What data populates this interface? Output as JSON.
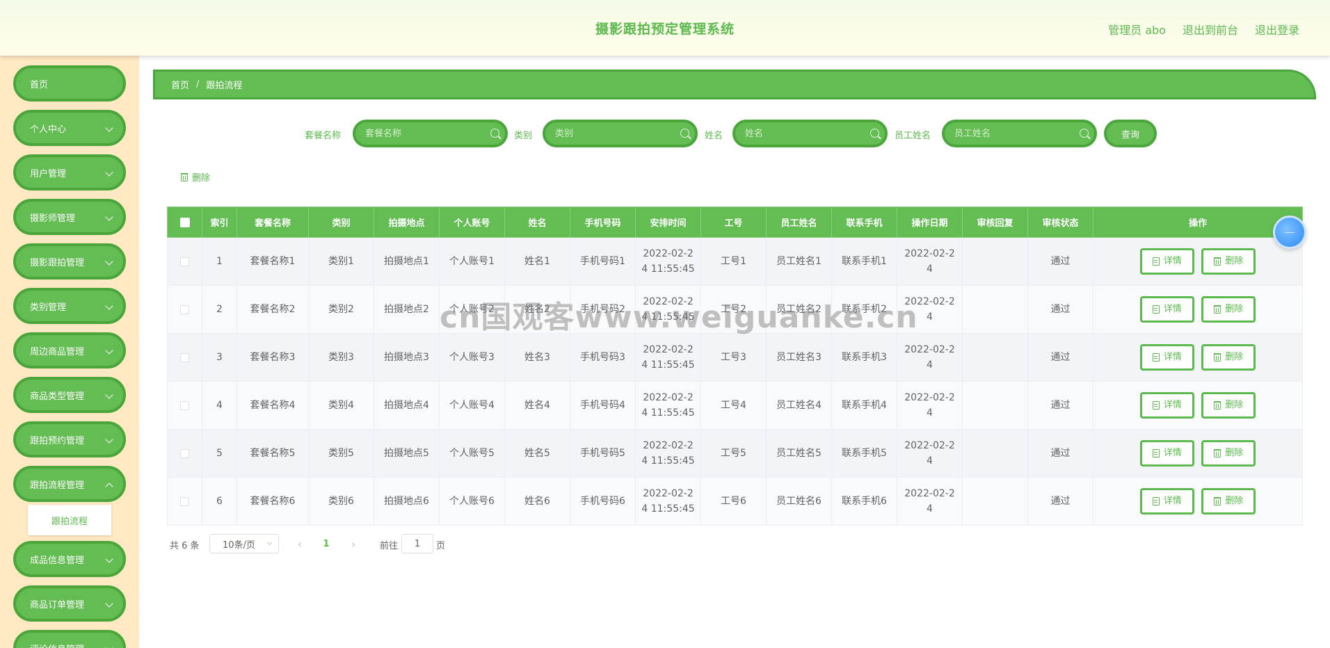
{
  "header": {
    "title": "摄影跟拍预定管理系统",
    "admin_label": "管理员 abo",
    "to_front": "退出到前台",
    "logout": "退出登录"
  },
  "sidebar": {
    "items": [
      {
        "label": "首页"
      },
      {
        "label": "个人中心"
      },
      {
        "label": "用户管理"
      },
      {
        "label": "摄影师管理"
      },
      {
        "label": "摄影跟拍管理"
      },
      {
        "label": "类别管理"
      },
      {
        "label": "周边商品管理"
      },
      {
        "label": "商品类型管理"
      },
      {
        "label": "跟拍预约管理"
      },
      {
        "label": "跟拍流程管理"
      },
      {
        "label": "成品信息管理"
      },
      {
        "label": "商品订单管理"
      },
      {
        "label": "评论信息管理"
      }
    ],
    "active_sub": "跟拍流程"
  },
  "breadcrumb": {
    "home": "首页",
    "separator": "/",
    "current": "跟拍流程"
  },
  "search": {
    "fields": [
      {
        "label": "套餐名称",
        "placeholder": "套餐名称"
      },
      {
        "label": "类别",
        "placeholder": "类别"
      },
      {
        "label": "姓名",
        "placeholder": "姓名"
      },
      {
        "label": "员工姓名",
        "placeholder": "员工姓名"
      }
    ],
    "query_label": "查询"
  },
  "toolbar": {
    "batch_delete_label": "删除"
  },
  "table": {
    "headers": [
      "索引",
      "套餐名称",
      "类别",
      "拍摄地点",
      "个人账号",
      "姓名",
      "手机号码",
      "安排时间",
      "工号",
      "员工姓名",
      "联系手机",
      "操作日期",
      "审核回复",
      "审核状态",
      "操作"
    ],
    "rows": [
      {
        "index": "1",
        "package": "套餐名称1",
        "category": "类别1",
        "location": "拍摄地点1",
        "account": "个人账号1",
        "name": "姓名1",
        "phone": "手机号码1",
        "time_a": "2022-02-2",
        "time_b": "4 11:55:45",
        "empno": "工号1",
        "staff": "员工姓名1",
        "contact": "联系手机1",
        "opdate_a": "2022-02-2",
        "opdate_b": "4",
        "reply": "",
        "status": "通过"
      },
      {
        "index": "2",
        "package": "套餐名称2",
        "category": "类别2",
        "location": "拍摄地点2",
        "account": "个人账号2",
        "name": "姓名2",
        "phone": "手机号码2",
        "time_a": "2022-02-2",
        "time_b": "4 11:55:45",
        "empno": "工号2",
        "staff": "员工姓名2",
        "contact": "联系手机2",
        "opdate_a": "2022-02-2",
        "opdate_b": "4",
        "reply": "",
        "status": "通过"
      },
      {
        "index": "3",
        "package": "套餐名称3",
        "category": "类别3",
        "location": "拍摄地点3",
        "account": "个人账号3",
        "name": "姓名3",
        "phone": "手机号码3",
        "time_a": "2022-02-2",
        "time_b": "4 11:55:45",
        "empno": "工号3",
        "staff": "员工姓名3",
        "contact": "联系手机3",
        "opdate_a": "2022-02-2",
        "opdate_b": "4",
        "reply": "",
        "status": "通过"
      },
      {
        "index": "4",
        "package": "套餐名称4",
        "category": "类别4",
        "location": "拍摄地点4",
        "account": "个人账号4",
        "name": "姓名4",
        "phone": "手机号码4",
        "time_a": "2022-02-2",
        "time_b": "4 11:55:45",
        "empno": "工号4",
        "staff": "员工姓名4",
        "contact": "联系手机4",
        "opdate_a": "2022-02-2",
        "opdate_b": "4",
        "reply": "",
        "status": "通过"
      },
      {
        "index": "5",
        "package": "套餐名称5",
        "category": "类别5",
        "location": "拍摄地点5",
        "account": "个人账号5",
        "name": "姓名5",
        "phone": "手机号码5",
        "time_a": "2022-02-2",
        "time_b": "4 11:55:45",
        "empno": "工号5",
        "staff": "员工姓名5",
        "contact": "联系手机5",
        "opdate_a": "2022-02-2",
        "opdate_b": "4",
        "reply": "",
        "status": "通过"
      },
      {
        "index": "6",
        "package": "套餐名称6",
        "category": "类别6",
        "location": "拍摄地点6",
        "account": "个人账号6",
        "name": "姓名6",
        "phone": "手机号码6",
        "time_a": "2022-02-2",
        "time_b": "4 11:55:45",
        "empno": "工号6",
        "staff": "员工姓名6",
        "contact": "联系手机6",
        "opdate_a": "2022-02-2",
        "opdate_b": "4",
        "reply": "",
        "status": "通过"
      }
    ],
    "detail_label": "详情",
    "delete_label": "删除"
  },
  "pagination": {
    "total": "共 6 条",
    "page_size": "10条/页",
    "current_page": "1",
    "goto_prefix": "前往",
    "goto_value": "1",
    "goto_suffix": "页"
  },
  "watermark": "cn国观客www.weiguanke.cn",
  "colors": {
    "accent": "#63bd53",
    "accent_border": "#4aa63b",
    "sidebar_bg": "#ffe9c2",
    "link_green": "#5cb94e"
  }
}
